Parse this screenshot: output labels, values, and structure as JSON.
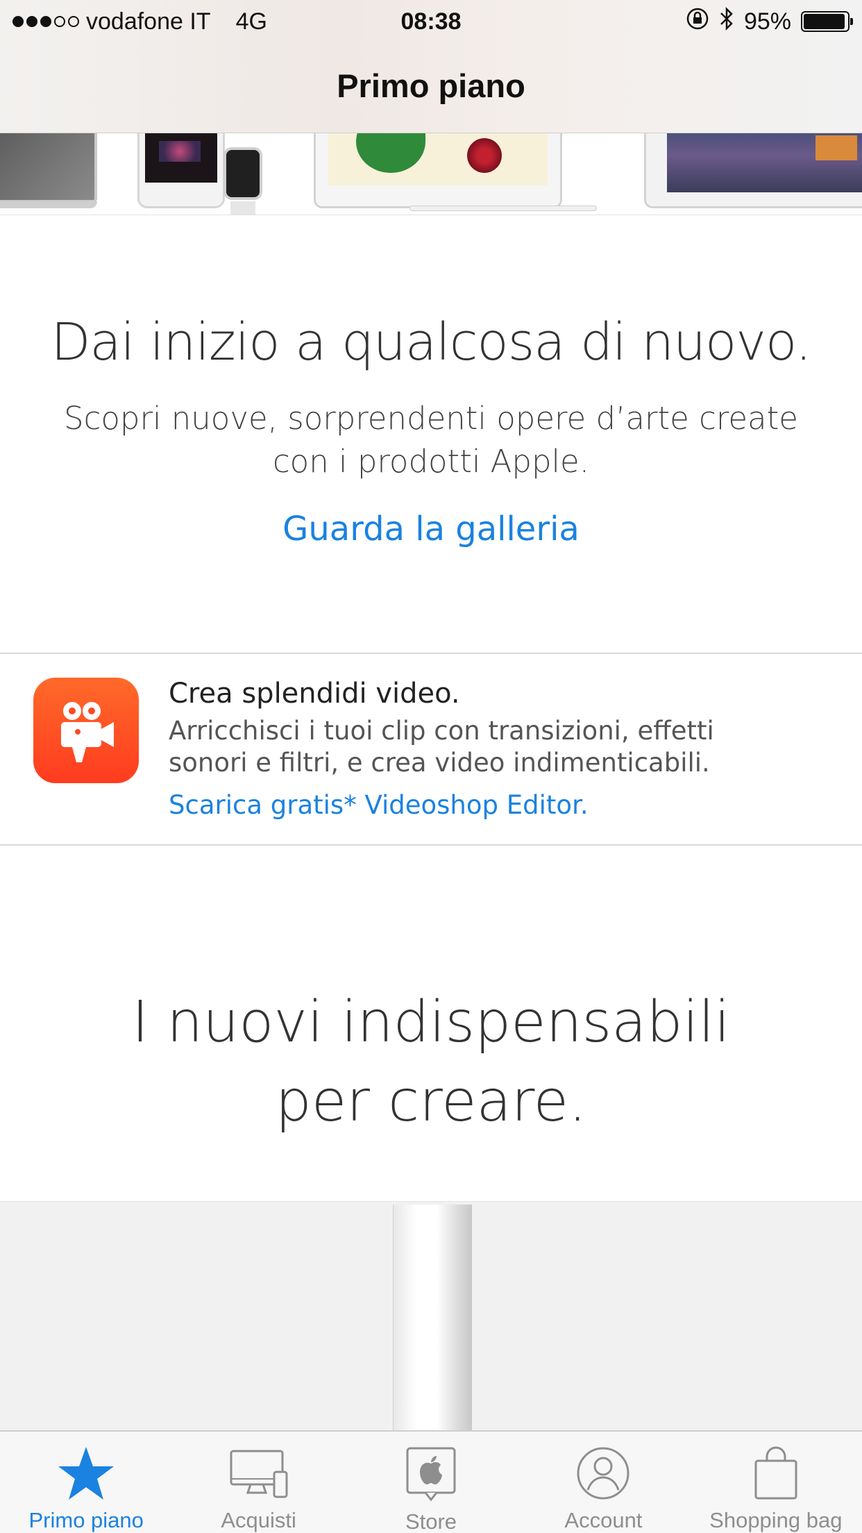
{
  "status_bar": {
    "carrier": "vodafone IT",
    "network": "4G",
    "time": "08:38",
    "battery_percent": "95%",
    "battery_level": 0.95,
    "signal_bars_filled": 3,
    "signal_bars_total": 5
  },
  "nav": {
    "title": "Primo piano"
  },
  "banner": {
    "headline": "Dai inizio a qualcosa di nuovo.",
    "subtitle": "Scopri nuove, sorprendenti opere d’arte create con i prodotti Apple.",
    "link": "Guarda la galleria"
  },
  "promo": {
    "title": "Crea splendidi video.",
    "description": "Arricchisci i tuoi clip con transizioni, effetti sonori e filtri, e crea video indimenticabili.",
    "link": "Scarica gratis* Videoshop Editor.",
    "icon": "video-camera-icon"
  },
  "essentials": {
    "title_line1": "I nuovi indispensabili",
    "title_line2": "per creare."
  },
  "tab_bar": {
    "tabs": [
      {
        "label": "Primo piano",
        "icon": "star-icon",
        "active": true
      },
      {
        "label": "Acquisti",
        "icon": "devices-icon",
        "active": false
      },
      {
        "label": "Store",
        "icon": "store-icon",
        "active": false
      },
      {
        "label": "Account",
        "icon": "account-icon",
        "active": false
      },
      {
        "label": "Shopping bag",
        "icon": "shopping-bag-icon",
        "active": false
      }
    ]
  },
  "colors": {
    "accent": "#1a82e0",
    "tab_inactive": "#8e8e8e",
    "app_icon": "#ff4a22"
  }
}
